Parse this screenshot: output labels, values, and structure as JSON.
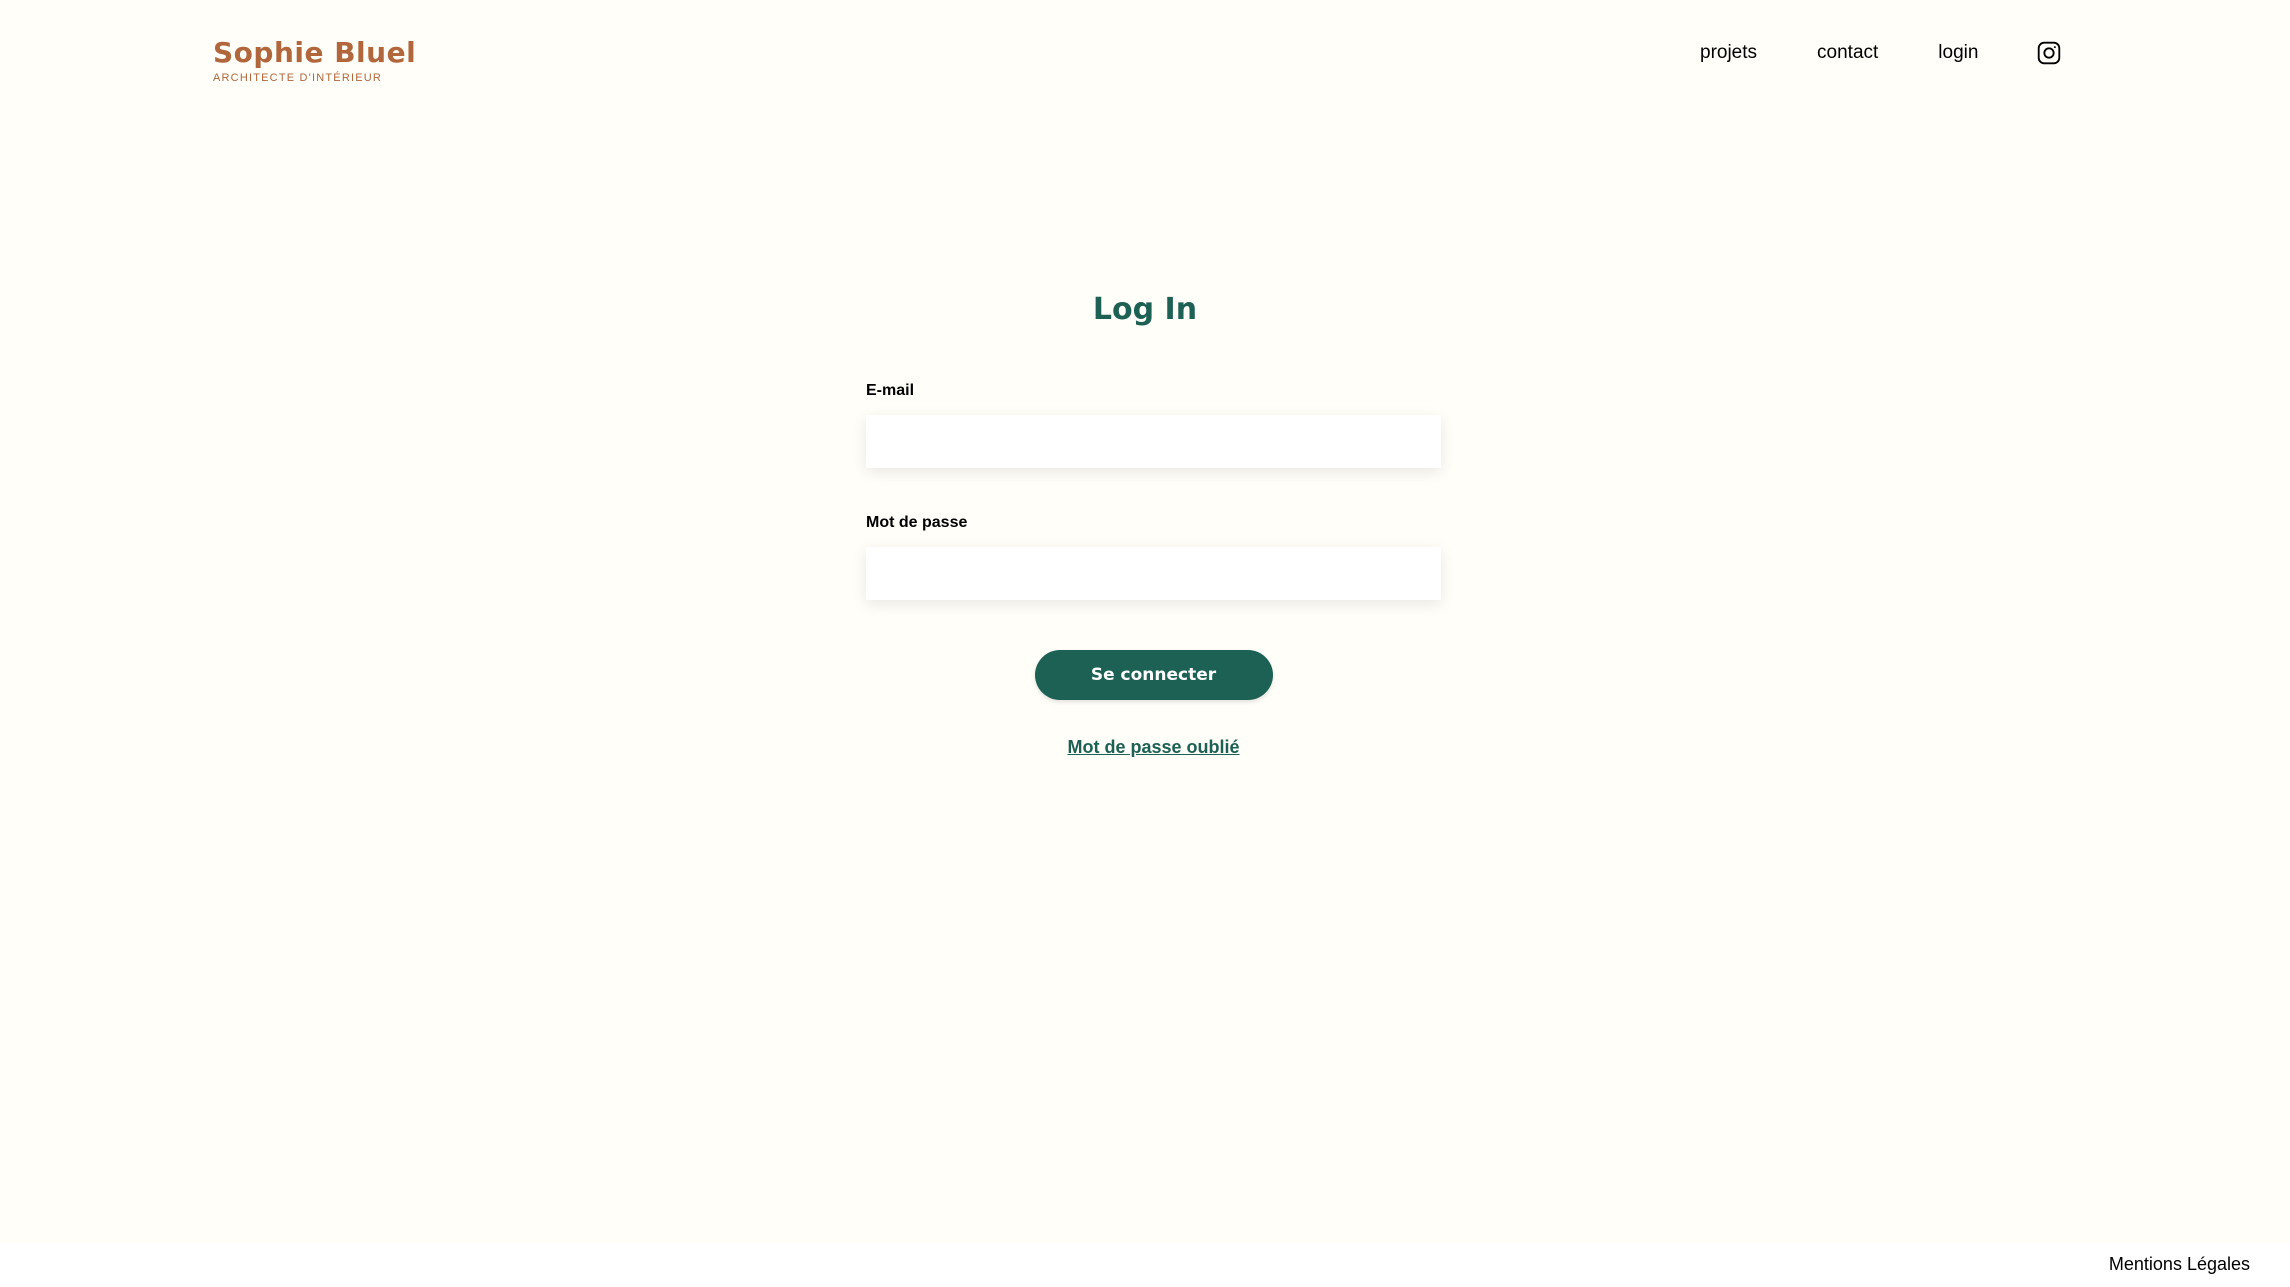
{
  "header": {
    "brand_name": "Sophie Bluel",
    "brand_subtitle": "ARCHITECTE D'INTÉRIEUR",
    "nav": {
      "projets": "projets",
      "contact": "contact",
      "login": "login",
      "instagram_icon": "instagram-icon"
    }
  },
  "login": {
    "title": "Log In",
    "email_label": "E-mail",
    "email_value": "",
    "password_label": "Mot de passe",
    "password_value": "",
    "submit_label": "Se connecter",
    "forgot_label": "Mot de passe oublié"
  },
  "footer": {
    "legal_label": "Mentions Légales"
  },
  "colors": {
    "background": "#FFFEF8",
    "brand": "#B1663C",
    "accent": "#1D6154",
    "text": "#000000",
    "input_bg": "#FFFFFF"
  }
}
